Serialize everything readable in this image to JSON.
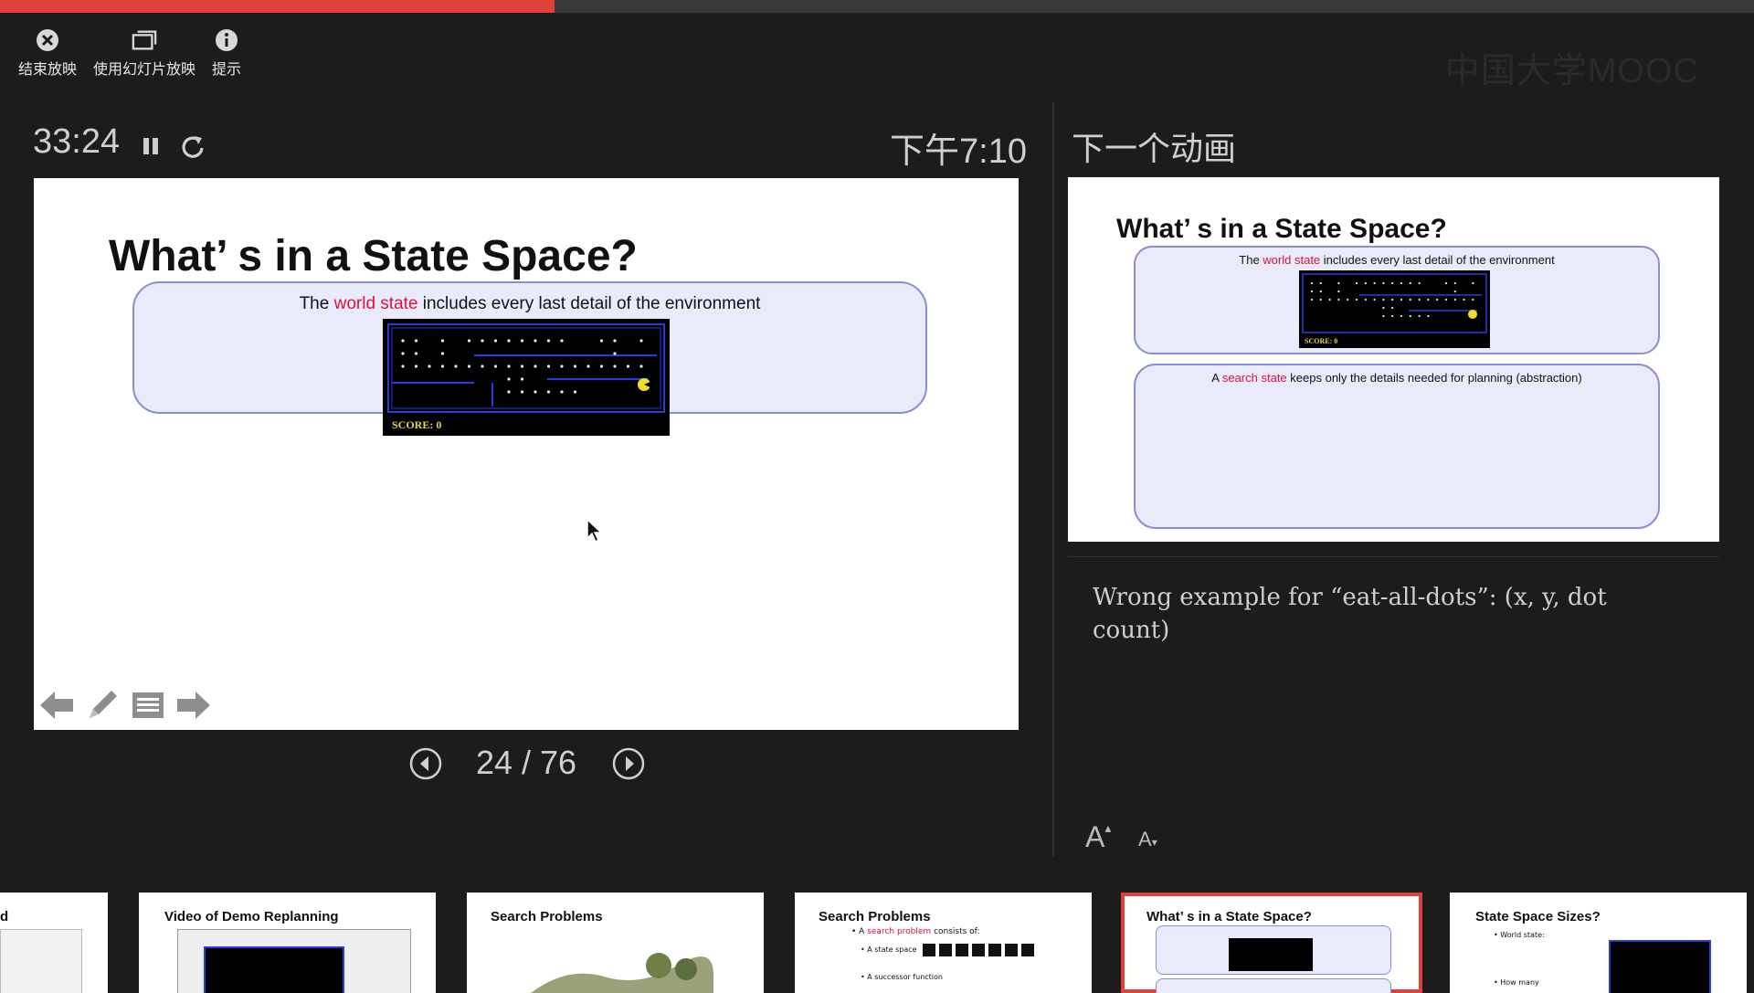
{
  "progress": {
    "fraction": 0.316
  },
  "toolbar": {
    "end_show": "结束放映",
    "use_slideshow": "使用幻灯片放映",
    "hint": "提示"
  },
  "watermark": "中国大学MOOC",
  "timer": {
    "elapsed": "33:24"
  },
  "clock": "下午7:10",
  "main_slide": {
    "title": "What’ s in a State Space?",
    "caption_pre": "The ",
    "caption_hl": "world state",
    "caption_post": " includes every last detail of the environment",
    "score": "SCORE:   0"
  },
  "pager": {
    "current_total": "24 / 76"
  },
  "next": {
    "label": "下一个动画",
    "title": "What’ s in a State Space?",
    "caption1_pre": "The ",
    "caption1_hl": "world state",
    "caption1_post": " includes every last detail of the environment",
    "caption2_pre": "A ",
    "caption2_hl": "search state",
    "caption2_post": " keeps only the details needed for planning (abstraction)",
    "score": "SCORE:   0"
  },
  "notes": "Wrong example for “eat-all-dots”: (x, y, dot count)",
  "font_controls": {
    "increase": "A",
    "decrease": "A"
  },
  "thumbnails": [
    {
      "title": "d"
    },
    {
      "title": "Video of Demo Replanning"
    },
    {
      "title": "Search Problems"
    },
    {
      "title": "Search Problems",
      "sub1_pre": "A ",
      "sub1_hl": "search problem",
      "sub1_post": " consists of:",
      "sub2": "A state space",
      "sub3": "A successor function"
    },
    {
      "title": "What’ s in a State Space?",
      "selected": true
    },
    {
      "title": "State Space Sizes?",
      "sub1": "World state:",
      "sub2": "How many"
    }
  ],
  "colors": {
    "accent": "#e0403a",
    "highlight": "#e0103a",
    "box_fill": "#e9ebfb"
  }
}
